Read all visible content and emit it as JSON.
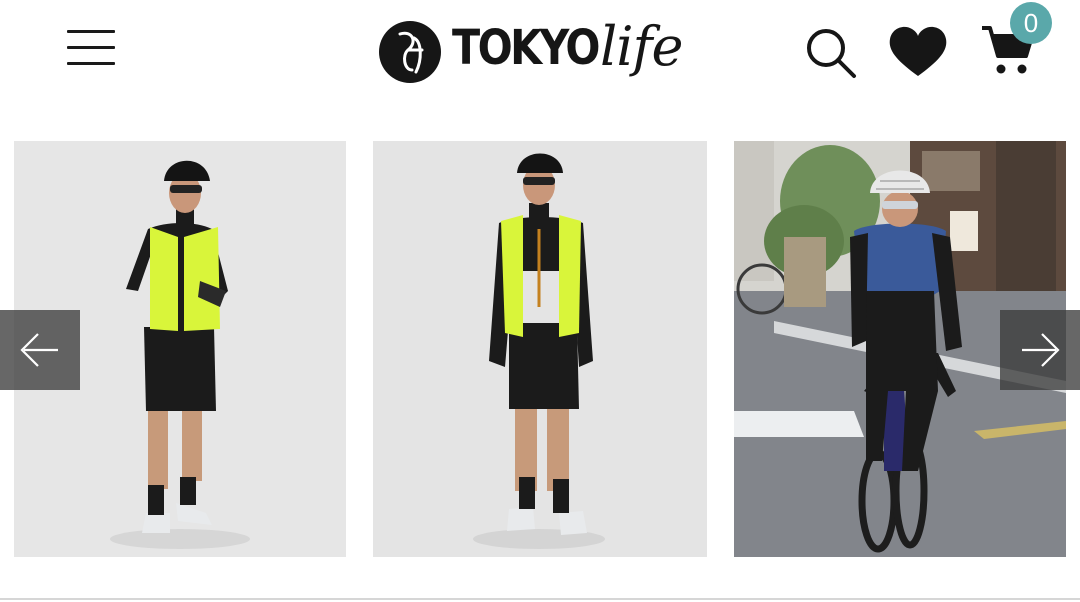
{
  "header": {
    "logo": {
      "wordmark": "TOKYO",
      "script": "life"
    },
    "cart_count": "0",
    "icons": [
      "hamburger-menu-icon",
      "search-icon",
      "heart-icon",
      "cart-icon"
    ]
  },
  "carousel": {
    "prev_icon": "arrow-left-icon",
    "next_icon": "arrow-right-icon",
    "slides": [
      {
        "content": "studio-photo-cyclist-neon-vest"
      },
      {
        "content": "studio-photo-cyclist-vest-unzipped"
      },
      {
        "content": "street-photo-cyclist-blue-vest-on-bike"
      }
    ]
  },
  "colors": {
    "badge": "#5aa8aa",
    "text": "#161616",
    "neon": "#d9f53a",
    "vest_blue": "#3a5a9a",
    "arrow_bg": "#3c3c3c"
  }
}
